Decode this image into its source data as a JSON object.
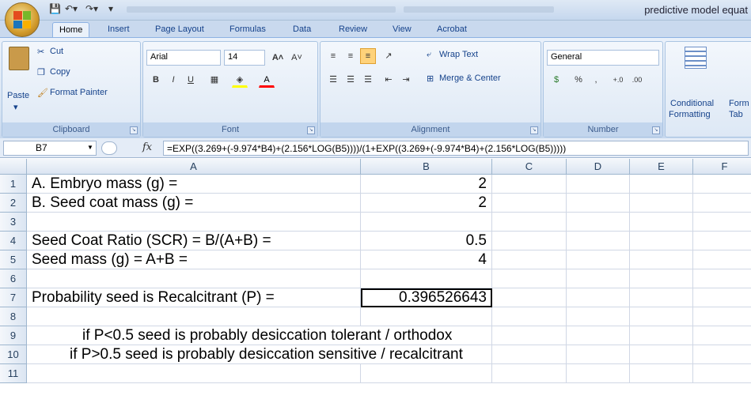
{
  "title": "predictive model equat",
  "tabs": [
    "Home",
    "Insert",
    "Page Layout",
    "Formulas",
    "Data",
    "Review",
    "View",
    "Acrobat"
  ],
  "active_tab": "Home",
  "clipboard": {
    "paste": "Paste",
    "cut": "Cut",
    "copy": "Copy",
    "format_painter": "Format Painter",
    "label": "Clipboard"
  },
  "font": {
    "name": "Arial",
    "size": "14",
    "bold": "B",
    "italic": "I",
    "underline": "U",
    "label": "Font"
  },
  "alignment": {
    "wrap": "Wrap Text",
    "merge": "Merge & Center",
    "label": "Alignment"
  },
  "number": {
    "format": "General",
    "percent": "%",
    "comma": ",",
    "inc": ".00→.0",
    "dec": ".0→.00",
    "label": "Number"
  },
  "styles": {
    "conditional": "Conditional",
    "formatting": "Formatting",
    "format_table_1": "Form",
    "format_table_2": "Tab"
  },
  "formula_bar": {
    "cell_ref": "B7",
    "fx": "fx",
    "formula": "=EXP((3.269+(-9.974*B4)+(2.156*LOG(B5))))/(1+EXP((3.269+(-9.974*B4)+(2.156*LOG(B5)))))"
  },
  "columns": [
    "A",
    "B",
    "C",
    "D",
    "E",
    "F"
  ],
  "rows": [
    {
      "num": "1",
      "a": "A. Embryo mass (g) =",
      "b": "2"
    },
    {
      "num": "2",
      "a": "B. Seed coat mass (g) =",
      "b": "2"
    },
    {
      "num": "3",
      "a": "",
      "b": ""
    },
    {
      "num": "4",
      "a": "Seed Coat Ratio (SCR) = B/(A+B) =",
      "b": "0.5"
    },
    {
      "num": "5",
      "a": "Seed mass (g) = A+B =",
      "b": "4"
    },
    {
      "num": "6",
      "a": "",
      "b": ""
    },
    {
      "num": "7",
      "a": "Probability seed is Recalcitrant (P) =",
      "b": "0.396526643"
    },
    {
      "num": "8",
      "a": "",
      "b": ""
    },
    {
      "num": "9",
      "a": "if P<0.5 seed is probably desiccation tolerant / orthodox",
      "b": ""
    },
    {
      "num": "10",
      "a": "if P>0.5 seed is probably desiccation sensitive / recalcitrant",
      "b": ""
    },
    {
      "num": "11",
      "a": "",
      "b": ""
    }
  ],
  "colors": {
    "selected_cell_border": "#000000",
    "header_blue": "#27415f"
  }
}
